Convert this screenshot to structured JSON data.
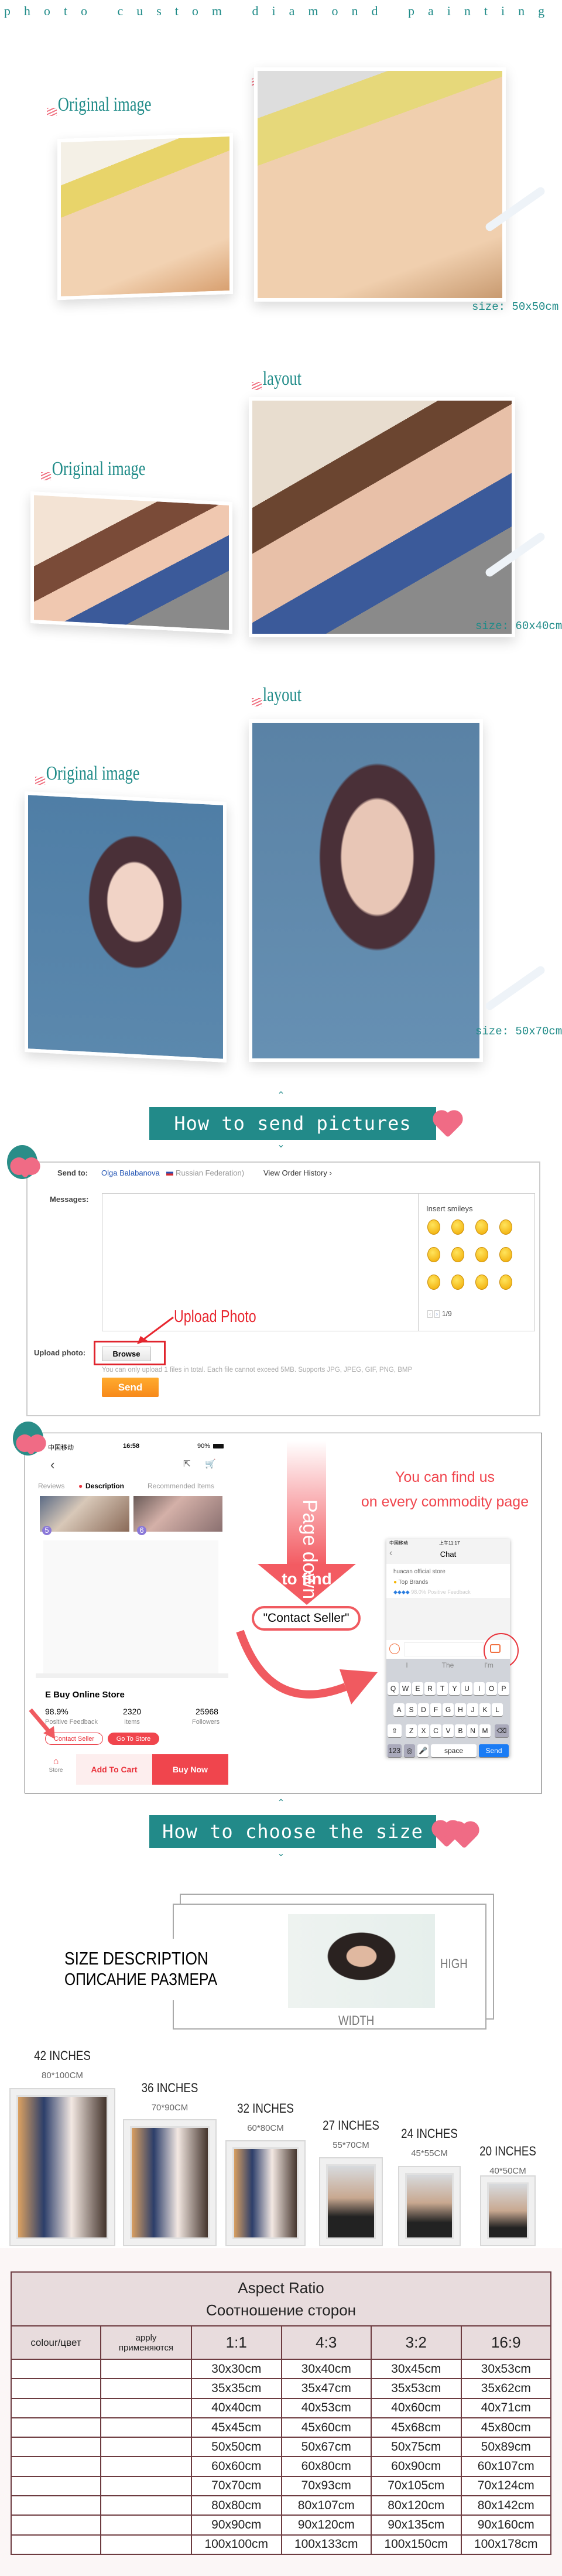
{
  "header": {
    "title": "photo custom diamond painting"
  },
  "examples": [
    {
      "original_label": "Original image",
      "layout_label": "layout",
      "size": "size: 50x50cm"
    },
    {
      "original_label": "Original image",
      "layout_label": "layout",
      "size": "size: 60x40cm"
    },
    {
      "original_label": "Original image",
      "layout_label": "layout",
      "size": "size: 50x70cm"
    }
  ],
  "send_section": {
    "banner": "How to send pictures",
    "send_to_label": "Send to:",
    "recipient": "Olga Balabanova",
    "country": "Russian Federation)",
    "view_order_history": "View Order History ›",
    "messages_label": "Messages:",
    "message_value": "",
    "smileys_title": "Insert smileys",
    "smileys_count": 12,
    "smileys_page": "1/9",
    "annotation": "Upload Photo",
    "upload_label": "Upload photo:",
    "browse": "Browse",
    "note": "You can only upload 1 files in total. Each file cannot exceed 5MB. Supports JPG, JPEG, GIF, PNG, BMP",
    "send": "Send",
    "colors": {
      "send": "#f7931e",
      "annotation": "#e8262f"
    }
  },
  "contact_section": {
    "phone": {
      "carrier": "中国移动",
      "time": "16:58",
      "battery": "90%",
      "tabs": [
        "Reviews",
        "Description",
        "Recommended Items"
      ],
      "image_badges": [
        "5",
        "6"
      ],
      "store_name": "E Buy Online Store",
      "stats": [
        {
          "value": "98.9%",
          "label": "Positive Feedback"
        },
        {
          "value": "2320",
          "label": "Items"
        },
        {
          "value": "25968",
          "label": "Followers"
        }
      ],
      "contact_seller": "Contact Seller",
      "go_to_store": "Go To Store",
      "store": "Store",
      "add_to_cart": "Add To Cart",
      "buy_now": "Buy Now"
    },
    "arrow_text": "Page down",
    "arrow_sub": "to find",
    "pill": "\"Contact Seller\"",
    "find_line1": "You can find us",
    "find_line2": "on every commodity page",
    "chat": {
      "carrier": "中国移动",
      "time": "上午11:17",
      "title": "Chat",
      "store": "huacan official store",
      "brand": "Top Brands",
      "feedback": "98.0% Positive Feedback",
      "suggestions": [
        "I",
        "The",
        "I'm"
      ],
      "keys": [
        [
          "Q",
          "W",
          "E",
          "R",
          "T",
          "Y",
          "U",
          "I",
          "O",
          "P"
        ],
        [
          "A",
          "S",
          "D",
          "F",
          "G",
          "H",
          "J",
          "K",
          "L"
        ],
        [
          "Z",
          "X",
          "C",
          "V",
          "B",
          "N",
          "M"
        ]
      ],
      "k123": "123",
      "space": "space",
      "send": "Send"
    }
  },
  "size_section": {
    "banner": "How to choose the size",
    "desc_en": "SIZE DESCRIPTION",
    "desc_ru": "ОПИСАНИЕ РАЗМЕРА",
    "high": "HIGH",
    "width": "WIDTH",
    "frames": [
      {
        "inches": "42 INCHES",
        "cm": "80*100CM"
      },
      {
        "inches": "36 INCHES",
        "cm": "70*90CM"
      },
      {
        "inches": "32 INCHES",
        "cm": "60*80CM"
      },
      {
        "inches": "27 INCHES",
        "cm": "55*70CM"
      },
      {
        "inches": "24 INCHES",
        "cm": "45*55CM"
      },
      {
        "inches": "20 INCHES",
        "cm": "40*50CM"
      }
    ]
  },
  "ratio_table": {
    "title": "Aspect Ratio",
    "title_ru": "Соотношение сторон",
    "col_colour": "colour/цвет",
    "col_apply": "apply",
    "col_apply_ru": "применяются",
    "ratios": [
      "1:1",
      "4:3",
      "3:2",
      "16:9"
    ],
    "rows": [
      [
        "30x30cm",
        "30x40cm",
        "30x45cm",
        "30x53cm"
      ],
      [
        "35x35cm",
        "35x47cm",
        "35x53cm",
        "35x62cm"
      ],
      [
        "40x40cm",
        "40x53cm",
        "40x60cm",
        "40x71cm"
      ],
      [
        "45x45cm",
        "45x60cm",
        "45x68cm",
        "45x80cm"
      ],
      [
        "50x50cm",
        "50x67cm",
        "50x75cm",
        "50x89cm"
      ],
      [
        "60x60cm",
        "60x80cm",
        "60x90cm",
        "60x107cm"
      ],
      [
        "70x70cm",
        "70x93cm",
        "70x105cm",
        "70x124cm"
      ],
      [
        "80x80cm",
        "80x107cm",
        "80x120cm",
        "80x142cm"
      ],
      [
        "90x90cm",
        "90x120cm",
        "90x135cm",
        "90x160cm"
      ],
      [
        "100x100cm",
        "100x133cm",
        "100x150cm",
        "100x178cm"
      ]
    ]
  }
}
